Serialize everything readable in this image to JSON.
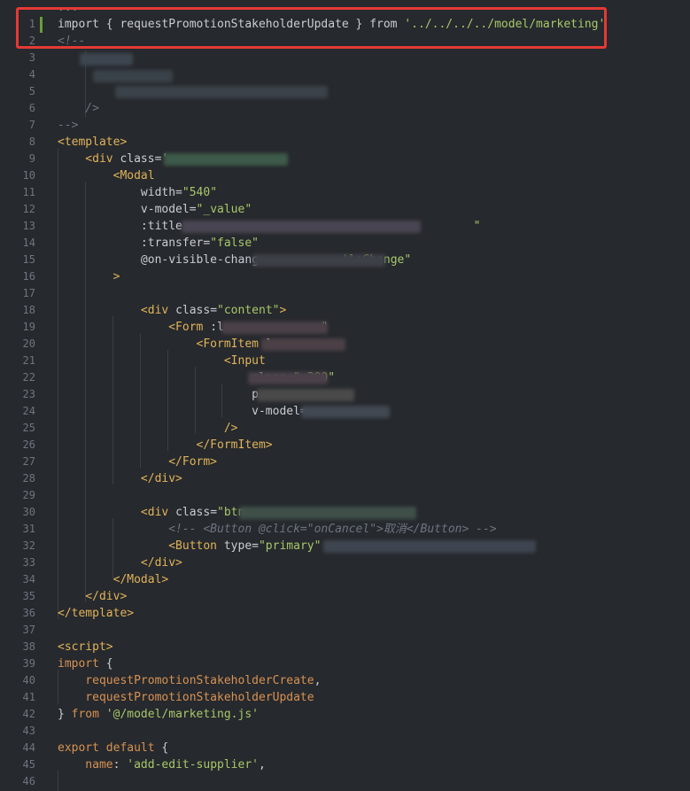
{
  "editor": {
    "lines": [
      {
        "n": "",
        "segs": [
          {
            "c": "t-ellipsis",
            "t": "..."
          }
        ]
      },
      {
        "n": "1",
        "segs": [
          {
            "c": "t-plain",
            "t": "import { requestPromotionStakeholderUpdate } from "
          },
          {
            "c": "t-str",
            "t": "'../../../../model/marketing'"
          }
        ]
      },
      {
        "n": "2",
        "segs": [
          {
            "c": "t-comment",
            "t": "<!--"
          }
        ]
      },
      {
        "n": "3",
        "segs": []
      },
      {
        "n": "4",
        "segs": []
      },
      {
        "n": "5",
        "segs": []
      },
      {
        "n": "6",
        "segs": [
          {
            "c": "t-comment",
            "t": "    />"
          }
        ]
      },
      {
        "n": "7",
        "segs": [
          {
            "c": "t-comment",
            "t": "-->"
          }
        ]
      },
      {
        "n": "8",
        "segs": [
          {
            "c": "t-tag",
            "t": "<template>"
          }
        ]
      },
      {
        "n": "9",
        "segs": [
          {
            "c": "t-tag",
            "t": "    <div "
          },
          {
            "c": "t-attr",
            "t": "class="
          },
          {
            "c": "t-str",
            "t": "'"
          }
        ]
      },
      {
        "n": "10",
        "segs": [
          {
            "c": "t-tag",
            "t": "        <Modal"
          }
        ]
      },
      {
        "n": "11",
        "segs": [
          {
            "c": "t-attr",
            "t": "            width="
          },
          {
            "c": "t-str",
            "t": "\"540\""
          }
        ]
      },
      {
        "n": "12",
        "segs": [
          {
            "c": "t-attr",
            "t": "            v-model="
          },
          {
            "c": "t-str",
            "t": "\"_value\""
          }
        ]
      },
      {
        "n": "13",
        "segs": [
          {
            "c": "t-attr",
            "t": "            :title"
          },
          {
            "c": "t-str",
            "t": "                                          \""
          }
        ]
      },
      {
        "n": "14",
        "segs": [
          {
            "c": "t-attr",
            "t": "            :transfer="
          },
          {
            "c": "t-str",
            "t": "\"false\""
          }
        ]
      },
      {
        "n": "15",
        "segs": [
          {
            "c": "t-attr",
            "t": "            @on-visible-chang"
          },
          {
            "c": "t-str",
            "t": "            'leChange\""
          }
        ]
      },
      {
        "n": "16",
        "segs": [
          {
            "c": "t-tag",
            "t": "        >"
          }
        ]
      },
      {
        "n": "17",
        "segs": []
      },
      {
        "n": "18",
        "segs": [
          {
            "c": "t-tag",
            "t": "            <div "
          },
          {
            "c": "t-attr",
            "t": "class="
          },
          {
            "c": "t-str",
            "t": "\"content\""
          },
          {
            "c": "t-tag",
            "t": ">"
          }
        ]
      },
      {
        "n": "19",
        "segs": [
          {
            "c": "t-tag",
            "t": "                <Form "
          },
          {
            "c": "t-attr",
            "t": ":l"
          },
          {
            "c": "t-str",
            "t": "              \""
          }
        ]
      },
      {
        "n": "20",
        "segs": [
          {
            "c": "t-tag",
            "t": "                    <FormItem "
          },
          {
            "c": "t-attr",
            "t": "l"
          }
        ]
      },
      {
        "n": "21",
        "segs": [
          {
            "c": "t-tag",
            "t": "                        <Input"
          }
        ]
      },
      {
        "n": "22",
        "segs": [
          {
            "c": "t-attr",
            "t": "                            class="
          },
          {
            "c": "t-str",
            "t": "\"w300\""
          }
        ]
      },
      {
        "n": "23",
        "segs": [
          {
            "c": "t-attr",
            "t": "                            p"
          }
        ]
      },
      {
        "n": "24",
        "segs": [
          {
            "c": "t-attr",
            "t": "                            v-model="
          }
        ]
      },
      {
        "n": "25",
        "segs": [
          {
            "c": "t-tag",
            "t": "                        />"
          }
        ]
      },
      {
        "n": "26",
        "segs": [
          {
            "c": "t-tag",
            "t": "                    </FormItem>"
          }
        ]
      },
      {
        "n": "27",
        "segs": [
          {
            "c": "t-tag",
            "t": "                </Form>"
          }
        ]
      },
      {
        "n": "28",
        "segs": [
          {
            "c": "t-tag",
            "t": "            </div>"
          }
        ]
      },
      {
        "n": "29",
        "segs": []
      },
      {
        "n": "30",
        "segs": [
          {
            "c": "t-tag",
            "t": "            <div "
          },
          {
            "c": "t-attr",
            "t": "class="
          },
          {
            "c": "t-str",
            "t": "\"btn"
          }
        ]
      },
      {
        "n": "31",
        "segs": [
          {
            "c": "t-comment",
            "t": "                <!-- <Button @click=\"onCancel\">取消</Button> -->"
          }
        ]
      },
      {
        "n": "32",
        "segs": [
          {
            "c": "t-tag",
            "t": "                <Button "
          },
          {
            "c": "t-attr",
            "t": "type="
          },
          {
            "c": "t-str",
            "t": "\"primary\""
          }
        ]
      },
      {
        "n": "33",
        "segs": [
          {
            "c": "t-tag",
            "t": "            </div>"
          }
        ]
      },
      {
        "n": "34",
        "segs": [
          {
            "c": "t-tag",
            "t": "        </Modal>"
          }
        ]
      },
      {
        "n": "35",
        "segs": [
          {
            "c": "t-tag",
            "t": "    </div>"
          }
        ]
      },
      {
        "n": "36",
        "segs": [
          {
            "c": "t-tag",
            "t": "</template>"
          }
        ]
      },
      {
        "n": "37",
        "segs": []
      },
      {
        "n": "38",
        "segs": [
          {
            "c": "t-tag",
            "t": "<script>"
          }
        ]
      },
      {
        "n": "39",
        "segs": [
          {
            "c": "t-kw",
            "t": "import"
          },
          {
            "c": "t-plain",
            "t": " {"
          }
        ]
      },
      {
        "n": "40",
        "segs": [
          {
            "c": "t-kw",
            "t": "    requestPromotionStakeholderCreate"
          },
          {
            "c": "t-plain",
            "t": ","
          }
        ]
      },
      {
        "n": "41",
        "segs": [
          {
            "c": "t-kw",
            "t": "    requestPromotionStakeholderUpdate"
          }
        ]
      },
      {
        "n": "42",
        "segs": [
          {
            "c": "t-plain",
            "t": "} "
          },
          {
            "c": "t-kw",
            "t": "from "
          },
          {
            "c": "t-str",
            "t": "'@/model/marketing.js'"
          }
        ]
      },
      {
        "n": "43",
        "segs": []
      },
      {
        "n": "44",
        "segs": [
          {
            "c": "t-kw",
            "t": "export default"
          },
          {
            "c": "t-plain",
            "t": " {"
          }
        ]
      },
      {
        "n": "45",
        "segs": [
          {
            "c": "t-kw",
            "t": "    name"
          },
          {
            "c": "t-plain",
            "t": ": "
          },
          {
            "c": "t-str",
            "t": "'add-edit-supplier'"
          },
          {
            "c": "t-plain",
            "t": ","
          }
        ]
      },
      {
        "n": "46",
        "segs": []
      }
    ]
  },
  "colors": {
    "background": "#26292d",
    "highlight_border": "#e53935",
    "modified_marker": "#6b9d3b"
  }
}
